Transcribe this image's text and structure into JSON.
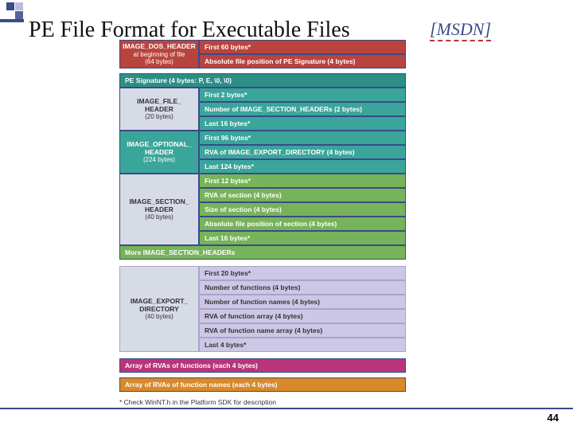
{
  "title": "PE File Format for Executable Files",
  "citation": "[MSDN]",
  "page_number": "44",
  "footnote": "* Check WinNT.h in the Platform SDK for description",
  "sections": {
    "dos": {
      "label": "IMAGE_DOS_HEADER",
      "sub1": "at beginning of file",
      "sub2": "(64 bytes)",
      "fields": [
        "First 60 bytes*",
        "Absolute file position of PE Signature (4 bytes)"
      ]
    },
    "pesig": "PE Signature (4 bytes: P, E, \\0, \\0)",
    "fileheader": {
      "label": "IMAGE_FILE_",
      "label2": "HEADER",
      "sub": "(20 bytes)",
      "fields": [
        "First 2 bytes*",
        "Number of IMAGE_SECTION_HEADERs (2 bytes)",
        "Last 16 bytes*"
      ]
    },
    "optheader": {
      "label": "IMAGE_OPTIONAL_",
      "label2": "HEADER",
      "sub": "(224 bytes)",
      "fields": [
        "First 96 bytes*",
        "RVA of IMAGE_EXPORT_DIRECTORY (4 bytes)",
        "Last 124 bytes*"
      ]
    },
    "secheader": {
      "label": "IMAGE_SECTION_",
      "label2": "HEADER",
      "sub": "(40 bytes)",
      "fields": [
        "First 12 bytes*",
        "RVA of section (4 bytes)",
        "Size of section (4 bytes)",
        "Absolute file position of section (4 bytes)",
        "Last 16 bytes*"
      ]
    },
    "moresec": "More IMAGE_SECTION_HEADERs",
    "exportdir": {
      "label": "IMAGE_EXPORT_",
      "label2": "DIRECTORY",
      "sub": "(40 bytes)",
      "fields": [
        "First 20 bytes*",
        "Number of functions (4 bytes)",
        "Number of function names (4 bytes)",
        "RVA of function array (4 bytes)",
        "RVA of function name array (4 bytes)",
        "Last 4 bytes*"
      ]
    },
    "funcarray": "Array of RVAs of functions (each 4 bytes)",
    "namearray": "Array of RVAs of function names (each 4 bytes)"
  }
}
